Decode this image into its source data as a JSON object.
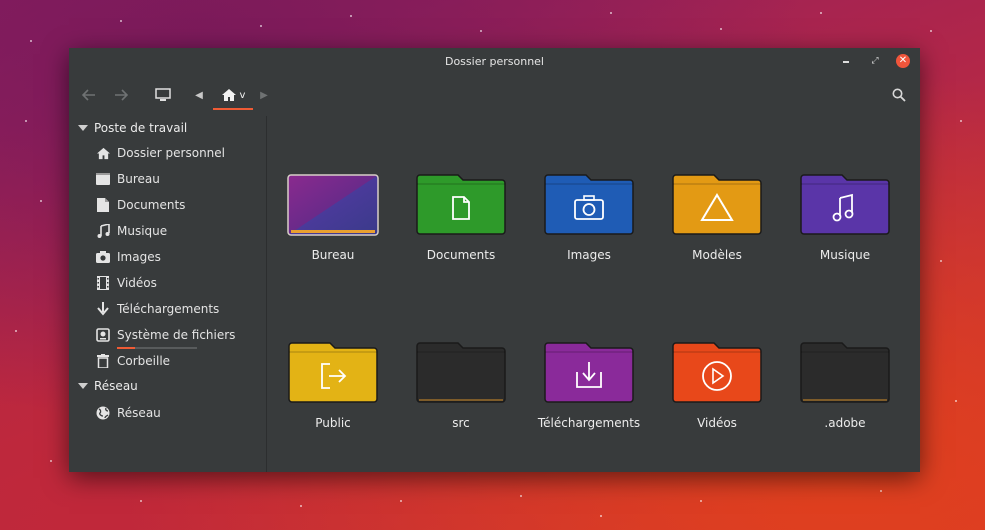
{
  "window": {
    "title": "Dossier personnel"
  },
  "toolbar": {
    "back_icon": "arrow-left-icon",
    "forward_icon": "arrow-right-icon",
    "computer_icon": "monitor-icon",
    "home_icon": "home-icon",
    "path_dropdown": "v",
    "search_icon": "search-icon",
    "accent": "#ef5b35"
  },
  "sidebar": {
    "sections": [
      {
        "label": "Poste de travail"
      },
      {
        "label": "Réseau"
      }
    ],
    "items": [
      {
        "label": "Dossier personnel",
        "icon": "home-icon"
      },
      {
        "label": "Bureau",
        "icon": "desktop-icon"
      },
      {
        "label": "Documents",
        "icon": "document-icon"
      },
      {
        "label": "Musique",
        "icon": "music-icon"
      },
      {
        "label": "Images",
        "icon": "camera-icon"
      },
      {
        "label": "Vidéos",
        "icon": "film-icon"
      },
      {
        "label": "Téléchargements",
        "icon": "download-icon"
      },
      {
        "label": "Système de fichiers",
        "icon": "drive-icon",
        "usage_fraction": 0.22
      },
      {
        "label": "Corbeille",
        "icon": "trash-icon"
      },
      {
        "label": "Réseau",
        "icon": "globe-icon"
      }
    ]
  },
  "files": [
    {
      "name": "Bureau",
      "kind": "desktop",
      "color": "#6b2a8a"
    },
    {
      "name": "Documents",
      "kind": "documents",
      "color": "#2e9a2a"
    },
    {
      "name": "Images",
      "kind": "images",
      "color": "#1f5cb5"
    },
    {
      "name": "Modèles",
      "kind": "templates",
      "color": "#e39a14"
    },
    {
      "name": "Musique",
      "kind": "music",
      "color": "#5a35a8"
    },
    {
      "name": "Public",
      "kind": "public",
      "color": "#e3b315"
    },
    {
      "name": "src",
      "kind": "plain",
      "color": "#2b2b2b"
    },
    {
      "name": "Téléchargements",
      "kind": "downloads",
      "color": "#8a2a9a"
    },
    {
      "name": "Vidéos",
      "kind": "videos",
      "color": "#e8481a"
    },
    {
      "name": ".adobe",
      "kind": "plain",
      "color": "#2b2b2b"
    }
  ]
}
